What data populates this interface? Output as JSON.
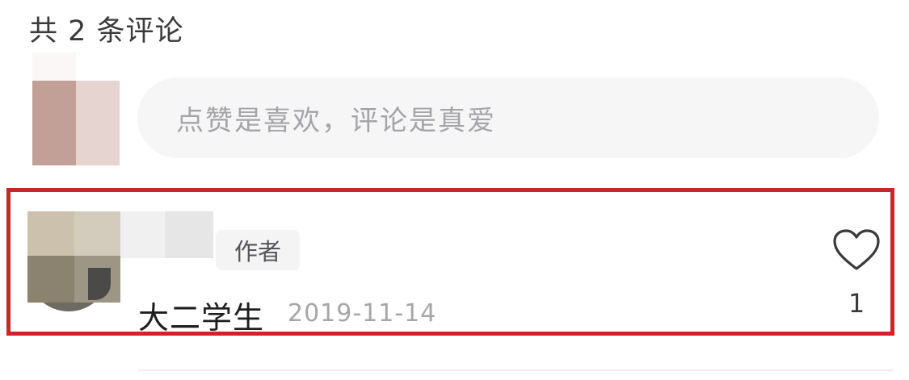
{
  "header": {
    "comment_count": "共 2 条评论"
  },
  "composer": {
    "placeholder": "点赞是喜欢，评论是真爱"
  },
  "comment": {
    "badge": "作者",
    "username": "大二学生",
    "date": "2019-11-14",
    "like_count": "1"
  },
  "colors": {
    "highlight_border": "#cc2428",
    "input_bg": "#f6f6f7",
    "placeholder": "#a5a5a9",
    "badge_bg": "#f4f4f5"
  },
  "icons": {
    "like": "heart-outline-icon"
  }
}
